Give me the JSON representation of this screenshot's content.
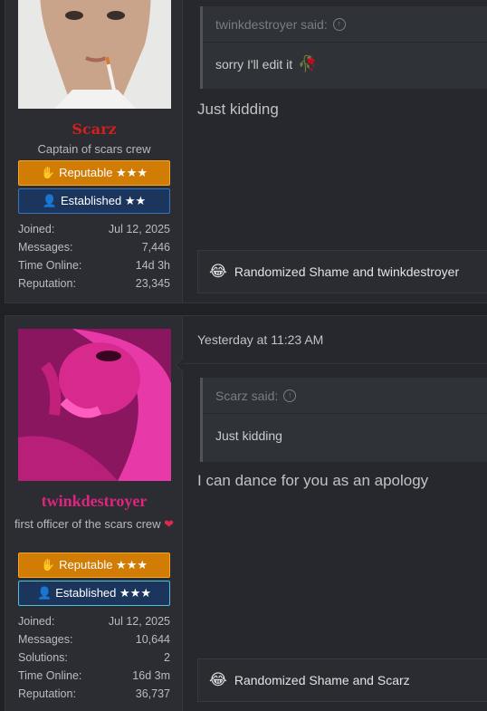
{
  "posts": [
    {
      "user": {
        "name": "Scarz",
        "title": "Captain of scars crew",
        "name_color": "#d21f1f",
        "badges": [
          {
            "label": "Reputable ★★★",
            "icon": "handshake-icon"
          },
          {
            "label": "Established ★★",
            "icon": "user-icon"
          }
        ],
        "stats": [
          {
            "label": "Joined:",
            "value": "Jul 12, 2025"
          },
          {
            "label": "Messages:",
            "value": "7,446"
          },
          {
            "label": "Time Online:",
            "value": "14d 3h"
          },
          {
            "label": "Reputation:",
            "value": "23,345"
          }
        ]
      },
      "quote": {
        "author": "twinkdestroyer said:",
        "text": "sorry I'll edit it"
      },
      "message": "Just kidding",
      "reactions": "Randomized Shame and twinkdestroyer"
    },
    {
      "timestamp": "Yesterday at 11:23 AM",
      "user": {
        "name": "twinkdestroyer",
        "title": "first officer of the scars crew",
        "name_color": "#e0237f",
        "badges": [
          {
            "label": "Reputable ★★★",
            "icon": "handshake-icon"
          },
          {
            "label": "Established ★★★",
            "icon": "user-icon"
          }
        ],
        "stats": [
          {
            "label": "Joined:",
            "value": "Jul 12, 2025"
          },
          {
            "label": "Messages:",
            "value": "10,644"
          },
          {
            "label": "Solutions:",
            "value": "2"
          },
          {
            "label": "Time Online:",
            "value": "16d 3m"
          },
          {
            "label": "Reputation:",
            "value": "36,737"
          }
        ]
      },
      "quote": {
        "author": "Scarz said:",
        "text": "Just kidding"
      },
      "message": "I can dance for you as an apology",
      "reactions": "Randomized Shame and Scarz"
    }
  ]
}
